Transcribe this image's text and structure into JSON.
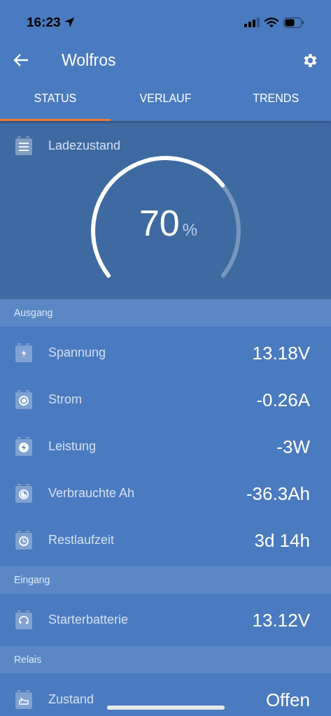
{
  "status_bar": {
    "time": "16:23"
  },
  "header": {
    "title": "Wolfros"
  },
  "tabs": [
    {
      "label": "STATUS",
      "selected": true
    },
    {
      "label": "VERLAUF",
      "selected": false
    },
    {
      "label": "TRENDS",
      "selected": false
    }
  ],
  "gauge": {
    "label": "Ladezustand",
    "reading": "70",
    "unit": "%"
  },
  "sections": [
    {
      "title": "Ausgang",
      "rows": [
        {
          "kind": "voltage",
          "label": "Spannung",
          "value": "13.18V"
        },
        {
          "kind": "current",
          "label": "Strom",
          "value": "-0.26A"
        },
        {
          "kind": "power",
          "label": "Leistung",
          "value": "-3W"
        },
        {
          "kind": "consumed",
          "label": "Verbrauchte Ah",
          "value": "-36.3Ah"
        },
        {
          "kind": "time",
          "label": "Restlaufzeit",
          "value": "3d 14h"
        }
      ]
    },
    {
      "title": "Eingang",
      "rows": [
        {
          "kind": "starter",
          "label": "Starterbatterie",
          "value": "13.12V"
        }
      ]
    },
    {
      "title": "Relais",
      "rows": [
        {
          "kind": "relay",
          "label": "Zustand",
          "value": "Offen"
        }
      ]
    }
  ]
}
